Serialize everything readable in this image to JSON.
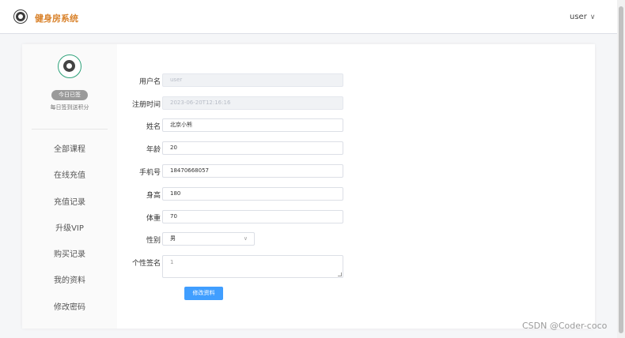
{
  "header": {
    "app_title": "健身房系统",
    "user_label": "user"
  },
  "sidebar": {
    "checkin_label": "今日已签",
    "checkin_tip": "每日签到送积分",
    "items": [
      {
        "label": "全部课程"
      },
      {
        "label": "在线充值"
      },
      {
        "label": "充值记录"
      },
      {
        "label": "升级VIP"
      },
      {
        "label": "购买记录"
      },
      {
        "label": "我的资料"
      },
      {
        "label": "修改密码"
      }
    ]
  },
  "form": {
    "username": {
      "label": "用户名",
      "value": "user"
    },
    "register_time": {
      "label": "注册时间",
      "value": "2023-06-20T12:16:16"
    },
    "name": {
      "label": "姓名",
      "value": "北京小熊"
    },
    "age": {
      "label": "年龄",
      "value": "20"
    },
    "phone": {
      "label": "手机号",
      "value": "18470668057"
    },
    "height": {
      "label": "身高",
      "value": "180"
    },
    "weight": {
      "label": "体重",
      "value": "70"
    },
    "gender": {
      "label": "性别",
      "value": "男"
    },
    "signature": {
      "label": "个性签名",
      "value": "1"
    },
    "submit_label": "修改资料"
  },
  "watermark": "CSDN @Coder-coco",
  "colors": {
    "brand": "#d9822b",
    "primary": "#409eff",
    "avatar_ring": "#2ea27a"
  }
}
